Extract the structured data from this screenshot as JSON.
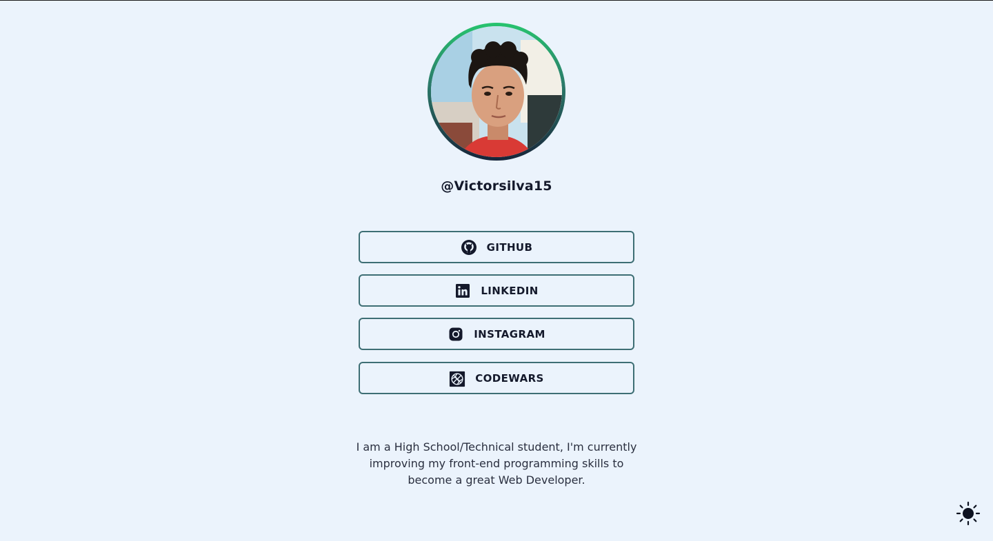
{
  "profile": {
    "username": "@Victorsilva15",
    "avatar_icon": "profile-photo",
    "ring_colors": [
      "#27c46e",
      "#17253a"
    ]
  },
  "links": [
    {
      "label": "GITHUB",
      "icon": "github-icon"
    },
    {
      "label": "LINKEDIN",
      "icon": "linkedin-icon"
    },
    {
      "label": "INSTAGRAM",
      "icon": "instagram-icon"
    },
    {
      "label": "CODEWARS",
      "icon": "codewars-icon"
    }
  ],
  "bio": {
    "line1": "I am a High School/Technical student, I'm currently",
    "line2": "improving my front-end programming skills to",
    "line3": "become a great Web Developer."
  },
  "theme_toggle": {
    "icon": "sun-icon"
  },
  "colors": {
    "background": "#ebf3fc",
    "text": "#14192b",
    "button_border": "#3d6e74"
  }
}
